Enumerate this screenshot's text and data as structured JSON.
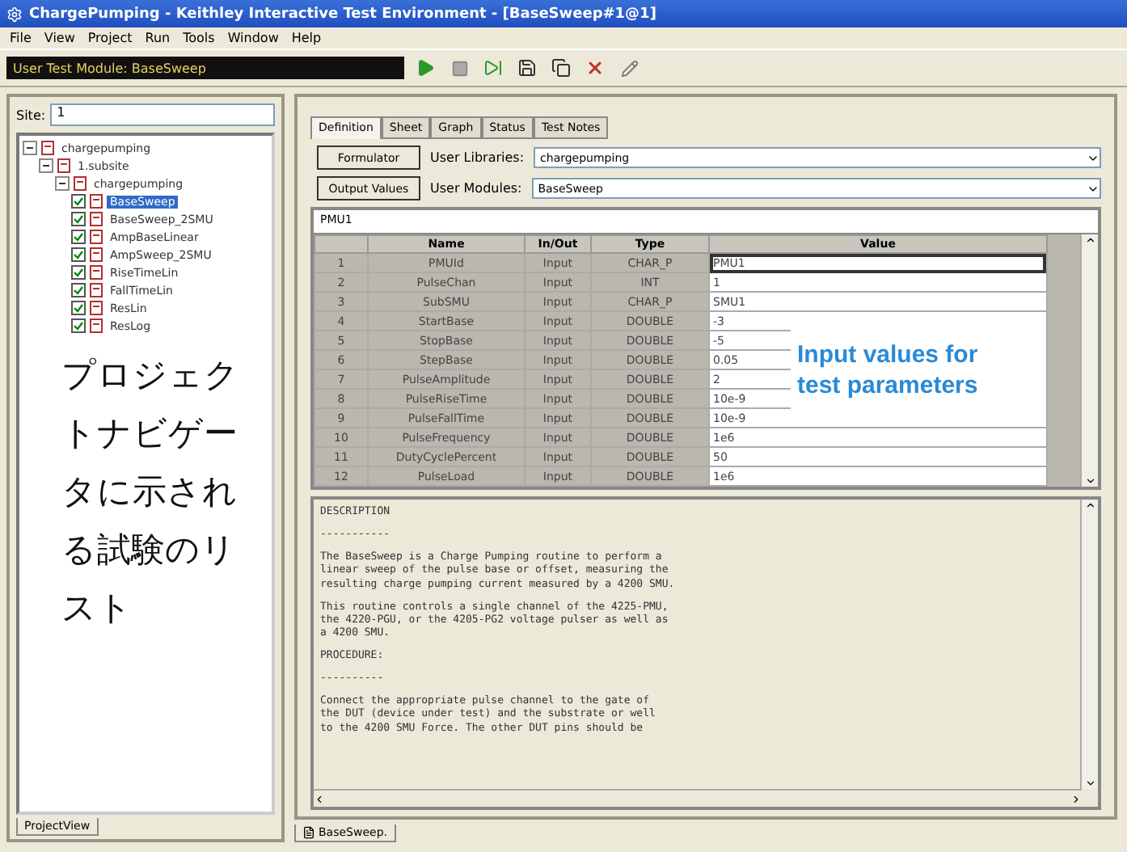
{
  "window": {
    "title": "ChargePumping - Keithley Interactive Test Environment - [BaseSweep#1@1]"
  },
  "menu": [
    "File",
    "View",
    "Project",
    "Run",
    "Tools",
    "Window",
    "Help"
  ],
  "toolbar": {
    "module_field": "User Test Module: BaseSweep"
  },
  "project_navigator": {
    "site_label": "Site:",
    "site_value": "1",
    "tree": [
      {
        "label": "chargepumping",
        "expanded": true,
        "children": [
          {
            "label": "1.subsite",
            "expanded": true,
            "children": [
              {
                "label": "chargepumping",
                "expanded": true,
                "children": [
                  {
                    "label": "BaseSweep",
                    "checked": true,
                    "selected": true
                  },
                  {
                    "label": "BaseSweep_2SMU",
                    "checked": true,
                    "selected": false
                  },
                  {
                    "label": "AmpBaseLinear",
                    "checked": true,
                    "selected": false
                  },
                  {
                    "label": "AmpSweep_2SMU",
                    "checked": true,
                    "selected": false
                  },
                  {
                    "label": "RiseTimeLin",
                    "checked": true,
                    "selected": false
                  },
                  {
                    "label": "FallTimeLin",
                    "checked": true,
                    "selected": false
                  },
                  {
                    "label": "ResLin",
                    "checked": true,
                    "selected": false
                  },
                  {
                    "label": "ResLog",
                    "checked": true,
                    "selected": false
                  }
                ]
              }
            ]
          }
        ]
      }
    ],
    "bottom_tab": "ProjectView"
  },
  "annotation_left": "プロジェクトナビゲータに示される試験のリスト",
  "annotation_right": "Input values for test parameters",
  "tabs": [
    {
      "label": "Definition",
      "selected": true
    },
    {
      "label": "Sheet",
      "selected": false
    },
    {
      "label": "Graph",
      "selected": false
    },
    {
      "label": "Status",
      "selected": false
    },
    {
      "label": "Test Notes",
      "selected": false
    }
  ],
  "buttons": [
    "Formulator",
    "Output Values"
  ],
  "user_libraries": {
    "label": "User Libraries:",
    "value": "chargepumping"
  },
  "user_modules": {
    "label": "User Modules:",
    "value": "BaseSweep"
  },
  "parameters": {
    "path": "PMU1",
    "columns": [
      "Name",
      "In/Out",
      "Type",
      "Value"
    ],
    "rows": [
      {
        "index": "1",
        "name": "PMUId",
        "io": "Input",
        "type": "CHAR_P",
        "value": "PMU1",
        "selected": true
      },
      {
        "index": "2",
        "name": "PulseChan",
        "io": "Input",
        "type": "INT",
        "value": "1",
        "selected": false
      },
      {
        "index": "3",
        "name": "SubSMU",
        "io": "Input",
        "type": "CHAR_P",
        "value": "SMU1",
        "selected": false
      },
      {
        "index": "4",
        "name": "StartBase",
        "io": "Input",
        "type": "DOUBLE",
        "value": "-3",
        "selected": false
      },
      {
        "index": "5",
        "name": "StopBase",
        "io": "Input",
        "type": "DOUBLE",
        "value": "-5",
        "selected": false
      },
      {
        "index": "6",
        "name": "StepBase",
        "io": "Input",
        "type": "DOUBLE",
        "value": "0.05",
        "selected": false
      },
      {
        "index": "7",
        "name": "PulseAmplitude",
        "io": "Input",
        "type": "DOUBLE",
        "value": "2",
        "selected": false
      },
      {
        "index": "8",
        "name": "PulseRiseTime",
        "io": "Input",
        "type": "DOUBLE",
        "value": "10e-9",
        "selected": false
      },
      {
        "index": "9",
        "name": "PulseFallTime",
        "io": "Input",
        "type": "DOUBLE",
        "value": "10e-9",
        "selected": false
      },
      {
        "index": "10",
        "name": "PulseFrequency",
        "io": "Input",
        "type": "DOUBLE",
        "value": "1e6",
        "selected": false
      },
      {
        "index": "11",
        "name": "DutyCyclePercent",
        "io": "Input",
        "type": "DOUBLE",
        "value": "50",
        "selected": false
      },
      {
        "index": "12",
        "name": "PulseLoad",
        "io": "Input",
        "type": "DOUBLE",
        "value": "1e6",
        "selected": false
      }
    ]
  },
  "description": [
    "DESCRIPTION",
    "-----------",
    "The BaseSweep is a Charge Pumping routine to perform a\nlinear sweep of the pulse base or offset, measuring the\nresulting charge pumping current measured by a 4200 SMU.",
    "This routine controls a single channel of the 4225-PMU,\nthe 4220-PGU, or the 4205-PG2 voltage pulser as well as\na 4200 SMU.",
    "PROCEDURE:",
    "----------",
    "Connect the appropriate pulse channel to the gate of\nthe DUT (device under test) and the substrate or well\nto the 4200 SMU Force. The other DUT pins should be"
  ],
  "document_tab": "BaseSweep."
}
